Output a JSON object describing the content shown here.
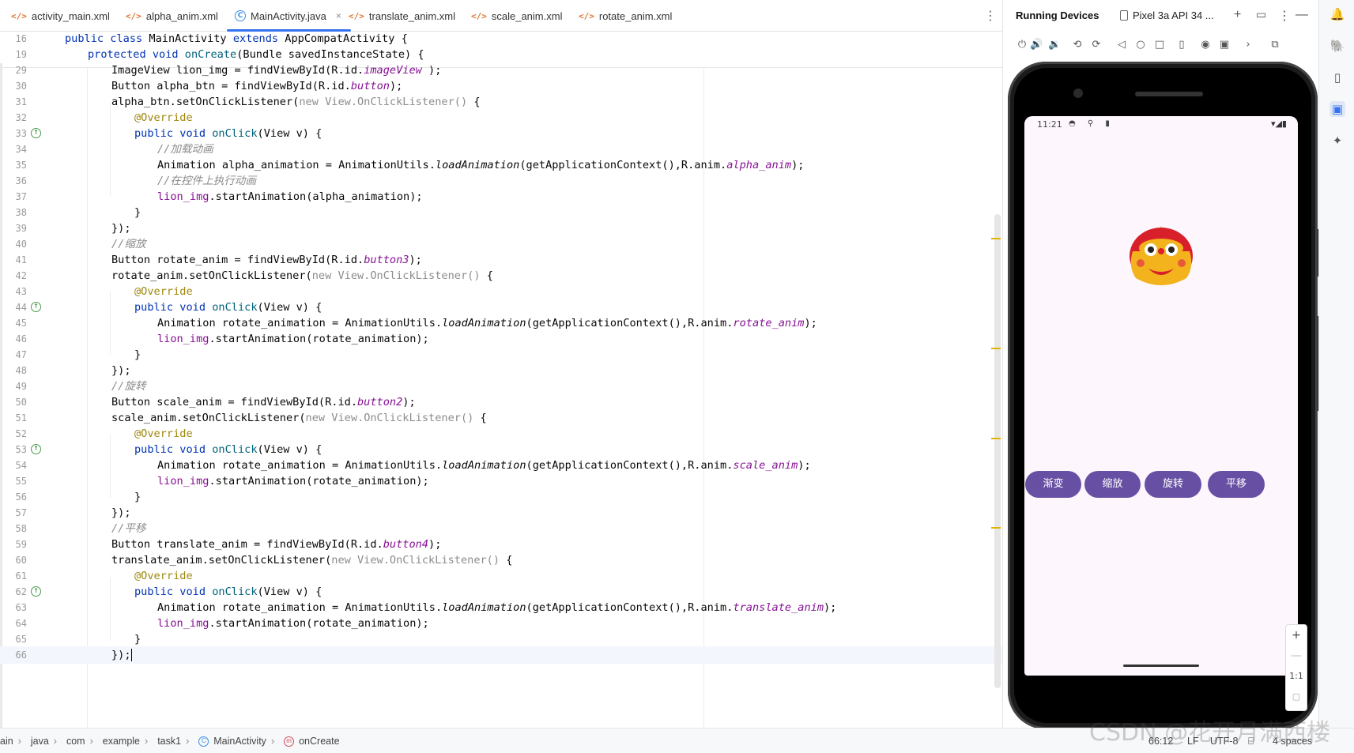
{
  "tabs": [
    {
      "icon": "</>",
      "label": "activity_main.xml",
      "active": false
    },
    {
      "icon": "</>",
      "label": "alpha_anim.xml",
      "active": false
    },
    {
      "icon": "C",
      "label": "MainActivity.java",
      "active": true,
      "close": "×"
    },
    {
      "icon": "</>",
      "label": "translate_anim.xml",
      "active": false
    },
    {
      "icon": "</>",
      "label": "scale_anim.xml",
      "active": false
    },
    {
      "icon": "</>",
      "label": "rotate_anim.xml",
      "active": false
    }
  ],
  "inspections": {
    "warnings": "4",
    "warning_icon": "⚠"
  },
  "code_lines": [
    {
      "n": "16",
      "sticky": true
    },
    {
      "n": "19",
      "sticky": true
    },
    {
      "n": "29"
    },
    {
      "n": "30"
    },
    {
      "n": "31"
    },
    {
      "n": "32"
    },
    {
      "n": "33",
      "impl": true
    },
    {
      "n": "34"
    },
    {
      "n": "35"
    },
    {
      "n": "36"
    },
    {
      "n": "37"
    },
    {
      "n": "38"
    },
    {
      "n": "39"
    },
    {
      "n": "40"
    },
    {
      "n": "41"
    },
    {
      "n": "42"
    },
    {
      "n": "43"
    },
    {
      "n": "44",
      "impl": true
    },
    {
      "n": "45"
    },
    {
      "n": "46"
    },
    {
      "n": "47"
    },
    {
      "n": "48"
    },
    {
      "n": "49"
    },
    {
      "n": "50"
    },
    {
      "n": "51"
    },
    {
      "n": "52"
    },
    {
      "n": "53",
      "impl": true
    },
    {
      "n": "54"
    },
    {
      "n": "55"
    },
    {
      "n": "56"
    },
    {
      "n": "57"
    },
    {
      "n": "58"
    },
    {
      "n": "59"
    },
    {
      "n": "60"
    },
    {
      "n": "61"
    },
    {
      "n": "62",
      "impl": true
    },
    {
      "n": "63"
    },
    {
      "n": "64"
    },
    {
      "n": "65"
    },
    {
      "n": "66",
      "current": true
    }
  ],
  "code_text": {
    "l16_a": "public class ",
    "l16_b": "MainActivity ",
    "l16_c": "extends ",
    "l16_d": "AppCompatActivity {",
    "l19_a": "protected void ",
    "l19_b": "onCreate",
    "l19_c": "(Bundle savedInstanceState) {",
    "l29_a": "ImageView lion_img = findViewById(R.id.",
    "l29_b": "imageView",
    "l29_c": " );",
    "l30_a": "Button alpha_btn = findViewById(R.id.",
    "l30_b": "button",
    "l30_c": ");",
    "l31_a": "alpha_btn.setOnClickListener(",
    "l31_b": "new View.OnClickListener()",
    "l31_c": " {",
    "override": "@Override",
    "onclick_a": "public void ",
    "onclick_b": "onClick",
    "onclick_c": "(View v) {",
    "l34": "//加载动画",
    "l35_a": "Animation alpha_animation = AnimationUtils.",
    "l35_b": "loadAnimation",
    "l35_c": "(getApplicationContext(),R.anim.",
    "l35_d": "alpha_anim",
    "l35_e": ");",
    "l36": "//在控件上执行动画",
    "l37_a": "lion_img",
    "l37_b": ".startAnimation(alpha_animation);",
    "close_brace": "}",
    "close_call": "});",
    "l40": "//缩放",
    "l41_a": "Button rotate_anim = findViewById(R.id.",
    "l41_b": "button3",
    "l41_c": ");",
    "l42_a": "rotate_anim.setOnClickListener(",
    "l42_b": "new View.OnClickListener()",
    "l42_c": " {",
    "l45_a": "Animation rotate_animation = AnimationUtils.",
    "l45_b": "loadAnimation",
    "l45_c": "(getApplicationContext(),R.anim.",
    "l45_d": "rotate_anim",
    "l45_e": ");",
    "l46_a": "lion_img",
    "l46_b": ".startAnimation(rotate_animation);",
    "l49": "//旋转",
    "l50_a": "Button scale_anim = findViewById(R.id.",
    "l50_b": "button2",
    "l50_c": ");",
    "l51_a": "scale_anim.setOnClickListener(",
    "l51_b": "new View.OnClickListener()",
    "l51_c": " {",
    "l54_a": "Animation rotate_animation = AnimationUtils.",
    "l54_b": "loadAnimation",
    "l54_c": "(getApplicationContext(),R.anim.",
    "l54_d": "scale_anim",
    "l54_e": ");",
    "l55_a": "lion_img",
    "l55_b": ".startAnimation(rotate_animation);",
    "l58": "//平移",
    "l59_a": "Button translate_anim = findViewById(R.id.",
    "l59_b": "button4",
    "l59_c": ");",
    "l60_a": "translate_anim.setOnClickListener(",
    "l60_b": "new View.OnClickListener()",
    "l60_c": " {",
    "l63_a": "Animation rotate_animation = AnimationUtils.",
    "l63_b": "loadAnimation",
    "l63_c": "(getApplicationContext(),R.anim.",
    "l63_d": "translate_anim",
    "l63_e": ");",
    "l64_a": "lion_img",
    "l64_b": ".startAnimation(rotate_animation);"
  },
  "breadcrumb": [
    "ain",
    "java",
    "com",
    "example",
    "task1",
    "MainActivity",
    "onCreate"
  ],
  "status": {
    "position": "66:12",
    "line_sep": "LF",
    "encoding": "UTF-8",
    "indent": "4 spaces"
  },
  "devices": {
    "title": "Running Devices",
    "device_tab": "Pixel 3a API 34 ...",
    "status_time": "11:21",
    "buttons": [
      "渐变",
      "缩放",
      "旋转",
      "平移"
    ],
    "zoom": {
      "in": "+",
      "out": "—",
      "ratio": "1:1"
    }
  },
  "watermark": "CSDN @花开月满西楼",
  "colors": {
    "accent": "#3574f0",
    "button": "#6750a4",
    "keyword": "#0033b3",
    "method": "#00627a",
    "annotation": "#9e880d",
    "field": "#871094",
    "comment": "#8c8c8c"
  }
}
